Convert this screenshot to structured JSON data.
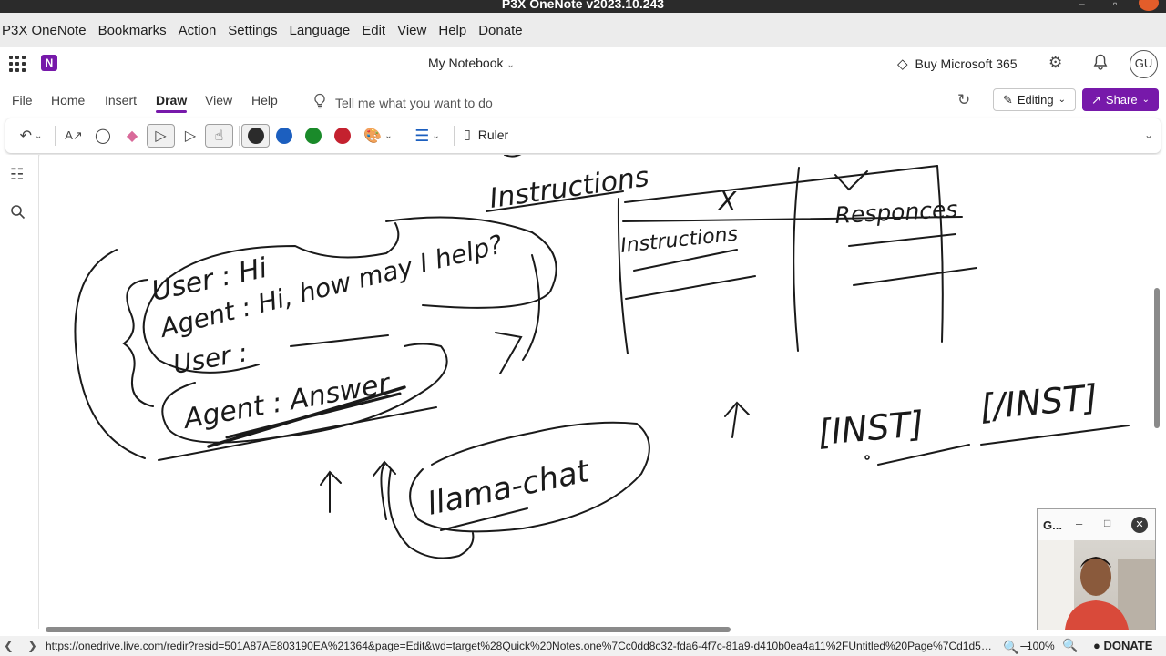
{
  "window": {
    "title": "P3X OneNote v2023.10.243",
    "controls": [
      "–",
      "▫"
    ]
  },
  "menubar": {
    "items": [
      "P3X OneNote",
      "Bookmarks",
      "Action",
      "Settings",
      "Language",
      "Edit",
      "View",
      "Help",
      "Donate"
    ]
  },
  "header": {
    "notebook_name": "My Notebook",
    "buy_label": "Buy Microsoft 365",
    "avatar_initials": "GU"
  },
  "ribbon": {
    "tabs": [
      "File",
      "Home",
      "Insert",
      "Draw",
      "View",
      "Help"
    ],
    "active_tab": "Draw",
    "tell_me_placeholder": "Tell me what you want to do",
    "editing_label": "Editing",
    "share_label": "Share"
  },
  "toolbar": {
    "ruler_label": "Ruler",
    "pen_colors": [
      "#2b2b2b",
      "#1c5fbf",
      "#1a8a2a",
      "#c4212f"
    ]
  },
  "canvas": {
    "ink_text": {
      "instructions_top": "Instructions",
      "x_header": "X",
      "y_header": "Y",
      "instructions_cell": "Instructions",
      "responses_cell": "Responces",
      "user_line1": "User : Hi",
      "agent_line1": "Agent : Hi, how may I help?",
      "user_line2": "User :",
      "agent_line2": "Agent : Answer",
      "llama_chat": "llama-chat",
      "inst_open": "[INST]",
      "inst_close": "[/INST]"
    }
  },
  "statusbar": {
    "url": "https://onedrive.live.com/redir?resid=501A87AE803190EA%21364&page=Edit&wd=target%28Quick%20Notes.one%7Cc0dd8c32-fda6-4f7c-81a9-d410b0ea4a11%2FUntitled%20Page%7Cd1d50f0b-...",
    "zoom": "100%",
    "donate_label": "DONATE"
  },
  "webcam": {
    "title": "G..."
  }
}
